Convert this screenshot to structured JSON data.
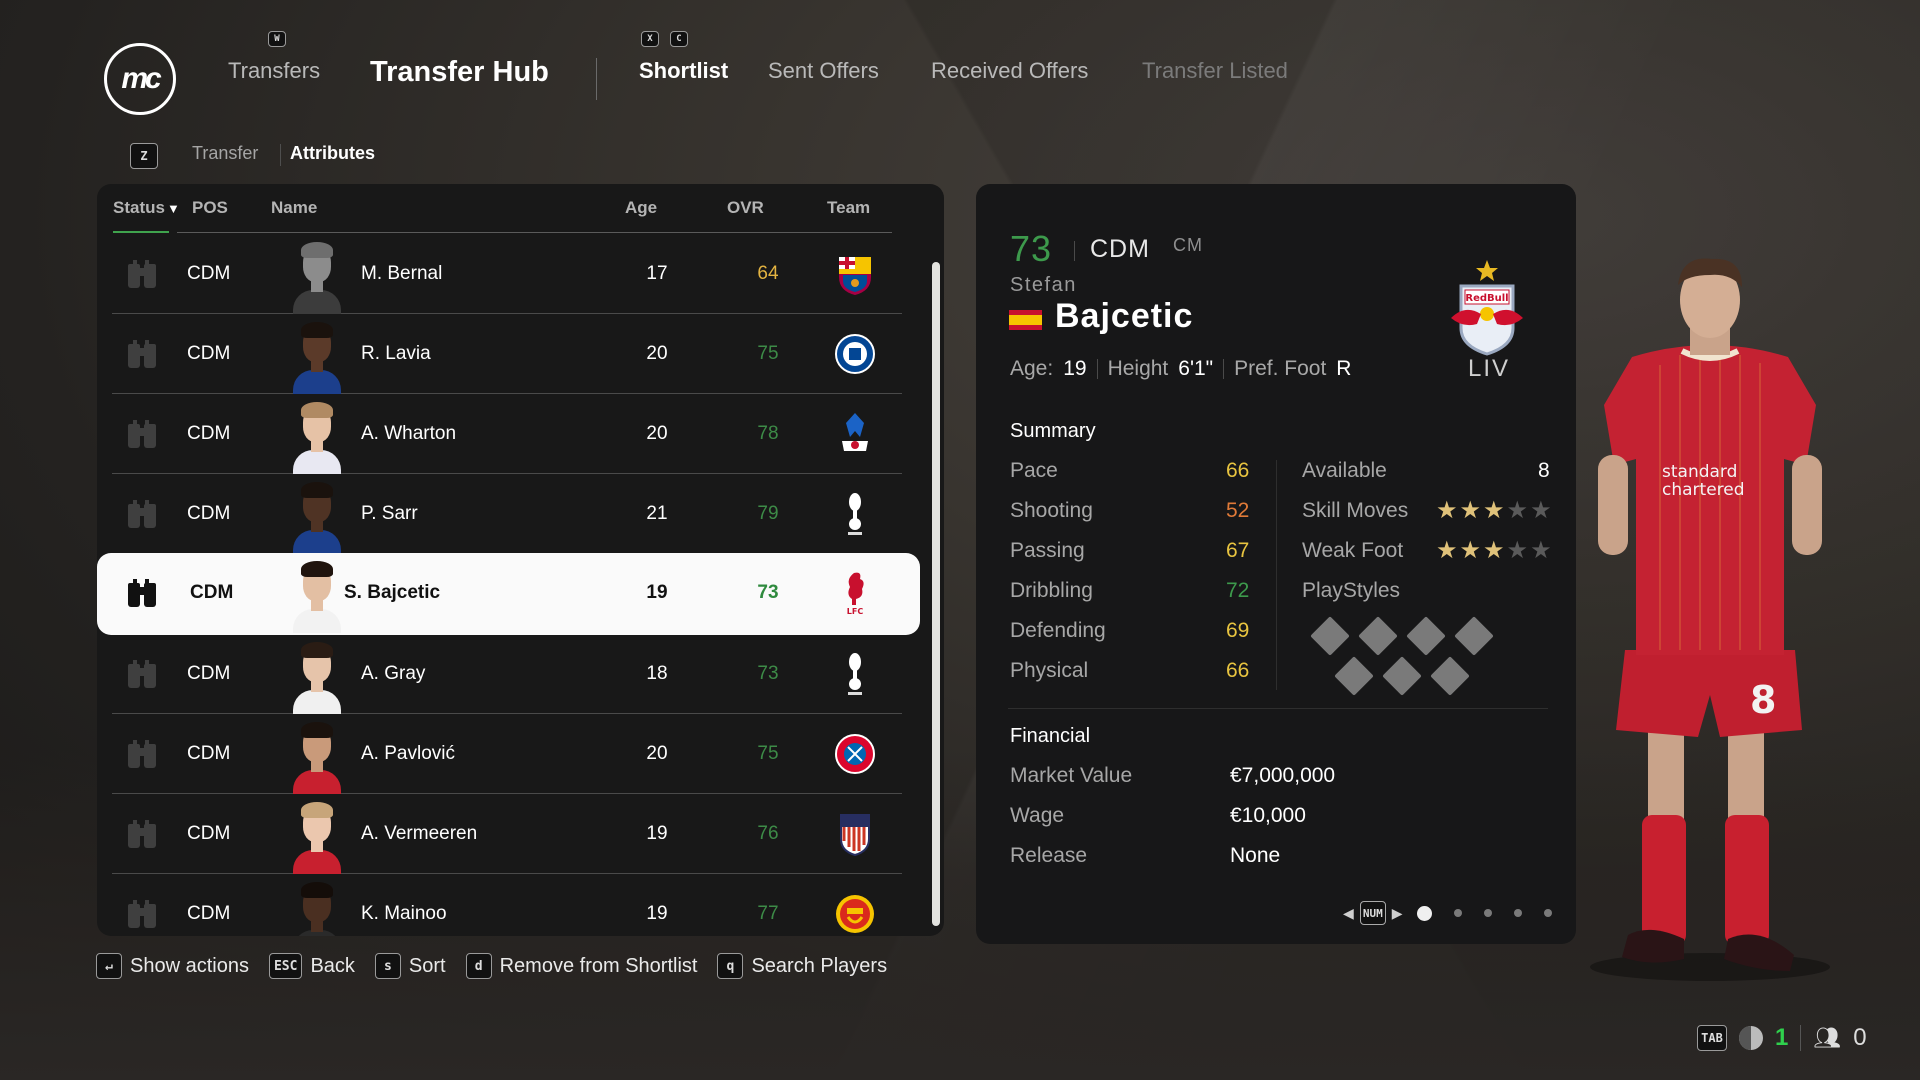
{
  "app": {
    "logo_text": "mc"
  },
  "header": {
    "key_transfers": "W",
    "transfers_label": "Transfers",
    "title": "Transfer Hub",
    "key_prev": "X",
    "key_next": "C",
    "tabs": [
      {
        "label": "Shortlist",
        "active": true
      },
      {
        "label": "Sent Offers",
        "active": false
      },
      {
        "label": "Received Offers",
        "active": false
      },
      {
        "label": "Transfer Listed",
        "active": false
      }
    ]
  },
  "subnav": {
    "key": "Z",
    "items": [
      {
        "label": "Transfer",
        "active": false
      },
      {
        "label": "Attributes",
        "active": true
      }
    ]
  },
  "table": {
    "columns": [
      "Status",
      "POS",
      "Name",
      "Age",
      "OVR",
      "Team"
    ],
    "sort_indicator": "▼",
    "rows": [
      {
        "pos": "CDM",
        "name": "M. Bernal",
        "age": "17",
        "ovr": "64",
        "ovr_color": "#e3b341",
        "team": "FC Barcelona",
        "selected": false
      },
      {
        "pos": "CDM",
        "name": "R. Lavia",
        "age": "20",
        "ovr": "75",
        "ovr_color": "#3d8b47",
        "team": "Chelsea",
        "selected": false
      },
      {
        "pos": "CDM",
        "name": "A. Wharton",
        "age": "20",
        "ovr": "78",
        "ovr_color": "#3d8b47",
        "team": "Crystal Palace",
        "selected": false
      },
      {
        "pos": "CDM",
        "name": "P. Sarr",
        "age": "21",
        "ovr": "79",
        "ovr_color": "#3d8b47",
        "team": "Tottenham Hotspur",
        "selected": false
      },
      {
        "pos": "CDM",
        "name": "S. Bajcetic",
        "age": "19",
        "ovr": "73",
        "ovr_color": "#2f8a3e",
        "team": "Liverpool",
        "selected": true
      },
      {
        "pos": "CDM",
        "name": "A. Gray",
        "age": "18",
        "ovr": "73",
        "ovr_color": "#3d8b47",
        "team": "Tottenham Hotspur",
        "selected": false
      },
      {
        "pos": "CDM",
        "name": "A. Pavlović",
        "age": "20",
        "ovr": "75",
        "ovr_color": "#3d8b47",
        "team": "FC Bayern München",
        "selected": false
      },
      {
        "pos": "CDM",
        "name": "A. Vermeeren",
        "age": "19",
        "ovr": "76",
        "ovr_color": "#3d8b47",
        "team": "Atlético de Madrid",
        "selected": false
      },
      {
        "pos": "CDM",
        "name": "K. Mainoo",
        "age": "19",
        "ovr": "77",
        "ovr_color": "#3d8b47",
        "team": "Manchester United",
        "selected": false
      }
    ]
  },
  "footer": {
    "hints": [
      {
        "key": "↵",
        "label": "Show actions"
      },
      {
        "key": "ESC",
        "label": "Back"
      },
      {
        "key": "s",
        "label": "Sort"
      },
      {
        "key": "d",
        "label": "Remove from Shortlist"
      },
      {
        "key": "q",
        "label": "Search Players"
      }
    ]
  },
  "player": {
    "ovr": "73",
    "position": "CDM",
    "alt_position": "CM",
    "first_name": "Stefan",
    "last_name": "Bajcetic",
    "nationality": "Spain",
    "age_label": "Age:",
    "age": "19",
    "height_label": "Height",
    "height": "6'1\"",
    "foot_label": "Pref. Foot",
    "foot": "R",
    "club_crest": "Red Bull Salzburg",
    "club_code": "LIV",
    "kit_number": "8",
    "summary": {
      "title": "Summary",
      "stats": [
        {
          "label": "Pace",
          "value": "66",
          "color": "#e8c440"
        },
        {
          "label": "Shooting",
          "value": "52",
          "color": "#e07a38"
        },
        {
          "label": "Passing",
          "value": "67",
          "color": "#e8c440"
        },
        {
          "label": "Dribbling",
          "value": "72",
          "color": "#3d9a4c"
        },
        {
          "label": "Defending",
          "value": "69",
          "color": "#e8c440"
        },
        {
          "label": "Physical",
          "value": "66",
          "color": "#e8c440"
        }
      ],
      "available_label": "Available",
      "available_value": "8",
      "skill_moves_label": "Skill Moves",
      "skill_moves": 3,
      "weak_foot_label": "Weak Foot",
      "weak_foot": 3,
      "stars_max": 5,
      "playstyles_label": "PlayStyles",
      "playstyles_count": 7
    },
    "financial": {
      "title": "Financial",
      "rows": [
        {
          "label": "Market Value",
          "value": "€7,000,000"
        },
        {
          "label": "Wage",
          "value": "€10,000"
        },
        {
          "label": "Release",
          "value": "None"
        }
      ]
    }
  },
  "pager": {
    "key": "NUM",
    "pages": 5,
    "current": 1
  },
  "status_bar": {
    "key": "TAB",
    "count_a": "1",
    "count_b": "0"
  }
}
